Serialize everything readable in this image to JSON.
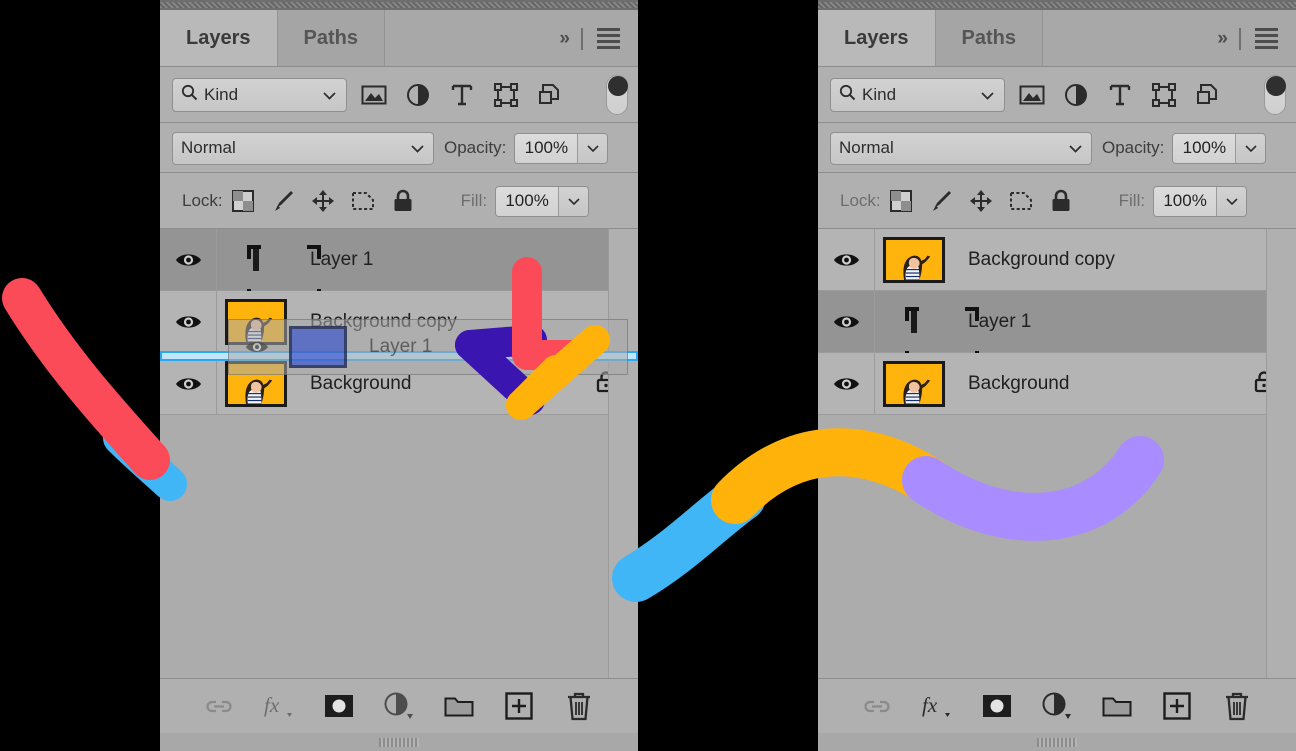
{
  "app": {
    "panel_bg": "#b0b0b0",
    "selected_row_bg": "#949494",
    "accent_blue": "#2aa8f2"
  },
  "panels": [
    {
      "id": "left",
      "state": "dragging",
      "tabs": [
        {
          "label": "Layers",
          "active": true
        },
        {
          "label": "Paths",
          "active": false
        }
      ],
      "tabbar_right": {
        "expand_label": "»",
        "menu_icon": "hamburger-menu-icon"
      },
      "filter": {
        "kind_label": "Kind",
        "search_icon": "search-icon",
        "chevron": "⌄",
        "icons": [
          "pixel-layer-filter-icon",
          "adjustment-layer-filter-icon",
          "type-layer-filter-icon",
          "shape-layer-filter-icon",
          "smart-object-filter-icon"
        ],
        "toggle_name": "filter-enable-toggle"
      },
      "blend": {
        "mode": "Normal",
        "opacity_label": "Opacity:",
        "opacity_value": "100%"
      },
      "lock": {
        "label": "Lock:",
        "icons": [
          "lock-transparent-pixels-icon",
          "lock-image-pixels-icon",
          "lock-position-icon",
          "lock-artboard-nesting-icon",
          "lock-all-icon"
        ],
        "fill_label": "Fill:",
        "fill_value": "100%"
      },
      "layers": [
        {
          "name": "Layer 1",
          "thumb": "blue",
          "selected": true,
          "visible": true,
          "locked": false,
          "bracketed": true
        },
        {
          "name": "Background copy",
          "thumb": "photo",
          "selected": false,
          "visible": true,
          "locked": false,
          "bracketed": false
        },
        {
          "name": "Background",
          "thumb": "photo",
          "selected": false,
          "visible": true,
          "locked": true,
          "bracketed": false
        }
      ],
      "drag_ghost": {
        "name": "Layer 1",
        "thumb": "blue"
      },
      "bottom_buttons": [
        "link-layers-icon",
        "layer-style-fx-icon",
        "add-layer-mask-icon",
        "new-adjustment-layer-icon",
        "new-group-icon",
        "new-layer-icon",
        "delete-layer-icon"
      ]
    },
    {
      "id": "right",
      "state": "result",
      "tabs": [
        {
          "label": "Layers",
          "active": true
        },
        {
          "label": "Paths",
          "active": false
        }
      ],
      "tabbar_right": {
        "expand_label": "»",
        "menu_icon": "hamburger-menu-icon"
      },
      "filter": {
        "kind_label": "Kind",
        "search_icon": "search-icon",
        "chevron": "⌄",
        "icons": [
          "pixel-layer-filter-icon",
          "adjustment-layer-filter-icon",
          "type-layer-filter-icon",
          "shape-layer-filter-icon",
          "smart-object-filter-icon"
        ],
        "toggle_name": "filter-enable-toggle"
      },
      "blend": {
        "mode": "Normal",
        "opacity_label": "Opacity:",
        "opacity_value": "100%"
      },
      "lock": {
        "label": "Lock:",
        "icons": [
          "lock-transparent-pixels-icon",
          "lock-image-pixels-icon",
          "lock-position-icon",
          "lock-artboard-nesting-icon",
          "lock-all-icon"
        ],
        "fill_label": "Fill:",
        "fill_value": "100%"
      },
      "layers": [
        {
          "name": "Background copy",
          "thumb": "photo",
          "selected": false,
          "visible": true,
          "locked": false,
          "bracketed": false
        },
        {
          "name": "Layer 1",
          "thumb": "blue",
          "selected": true,
          "visible": true,
          "locked": false,
          "bracketed": true
        },
        {
          "name": "Background",
          "thumb": "photo",
          "selected": false,
          "visible": true,
          "locked": true,
          "bracketed": false
        }
      ],
      "bottom_buttons": [
        "link-layers-icon",
        "layer-style-fx-icon",
        "add-layer-mask-icon",
        "new-adjustment-layer-icon",
        "new-group-icon",
        "new-layer-icon",
        "delete-layer-icon"
      ]
    }
  ],
  "annotations": {
    "strokes": [
      {
        "name": "red-swoosh-left",
        "color": "#fb4a58"
      },
      {
        "name": "blue-swoosh-left-tip",
        "color": "#41b6f7"
      },
      {
        "name": "red-hook-arrow",
        "color": "#fb4a58"
      },
      {
        "name": "indigo-check-arrow",
        "color": "#3a15b0"
      },
      {
        "name": "amber-check-arrow",
        "color": "#ffb20a"
      },
      {
        "name": "blue-wave",
        "color": "#41b6f7"
      },
      {
        "name": "amber-wave",
        "color": "#ffb20a"
      },
      {
        "name": "violet-wave",
        "color": "#a98cff"
      }
    ]
  }
}
